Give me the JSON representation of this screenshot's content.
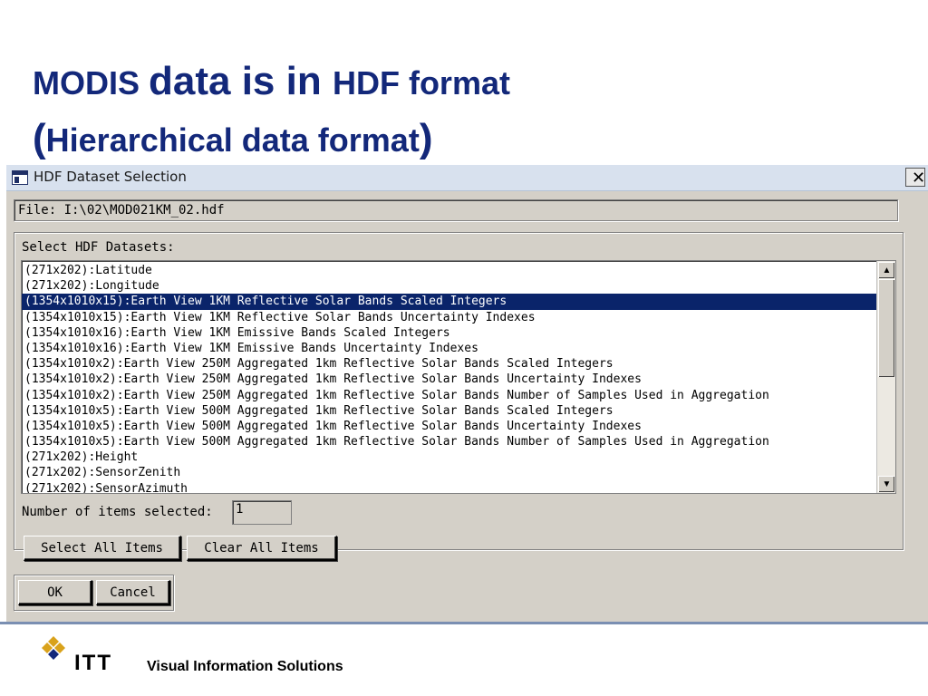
{
  "slide": {
    "title_part1": "MODIS ",
    "title_part2": "data is in ",
    "title_part3": "HDF format",
    "title_part4": "(",
    "title_part5": "Hierarchical data format",
    "title_part6": ")"
  },
  "dialog": {
    "title": "HDF Dataset Selection",
    "close_glyph": "✕",
    "file_path": "File: I:\\02\\MOD021KM_02.hdf",
    "group_label": "Select HDF Datasets:",
    "datasets": [
      "(271x202):Latitude",
      "(271x202):Longitude",
      "(1354x1010x15):Earth View 1KM Reflective Solar Bands Scaled Integers",
      "(1354x1010x15):Earth View 1KM Reflective Solar Bands Uncertainty Indexes",
      "(1354x1010x16):Earth View 1KM Emissive Bands Scaled Integers",
      "(1354x1010x16):Earth View 1KM Emissive Bands Uncertainty Indexes",
      "(1354x1010x2):Earth View 250M Aggregated 1km Reflective Solar Bands Scaled Integers",
      "(1354x1010x2):Earth View 250M Aggregated 1km Reflective Solar Bands Uncertainty Indexes",
      "(1354x1010x2):Earth View 250M Aggregated 1km Reflective Solar Bands Number of Samples Used in Aggregation",
      "(1354x1010x5):Earth View 500M Aggregated 1km Reflective Solar Bands Scaled Integers",
      "(1354x1010x5):Earth View 500M Aggregated 1km Reflective Solar Bands Uncertainty Indexes",
      "(1354x1010x5):Earth View 500M Aggregated 1km Reflective Solar Bands Number of Samples Used in Aggregation",
      "(271x202):Height",
      "(271x202):SensorZenith",
      "(271x202):SensorAzimuth"
    ],
    "selected_index": 2,
    "count_label": "Number of items selected:",
    "count_value": "1",
    "select_all_label": "Select All Items",
    "clear_all_label": "Clear All Items",
    "ok_label": "OK",
    "cancel_label": "Cancel",
    "scroll_up_glyph": "▲",
    "scroll_down_glyph": "▼"
  },
  "footer": {
    "brand": "ITT",
    "tagline": "Visual Information Solutions",
    "logo_icon": "itt-diamond-logo-icon"
  },
  "colors": {
    "title_color": "#13287a",
    "selection_background": "#0a246a",
    "dialog_face": "#d4d0c8",
    "logo_gold": "#d9a21b",
    "logo_navy": "#13287a"
  }
}
